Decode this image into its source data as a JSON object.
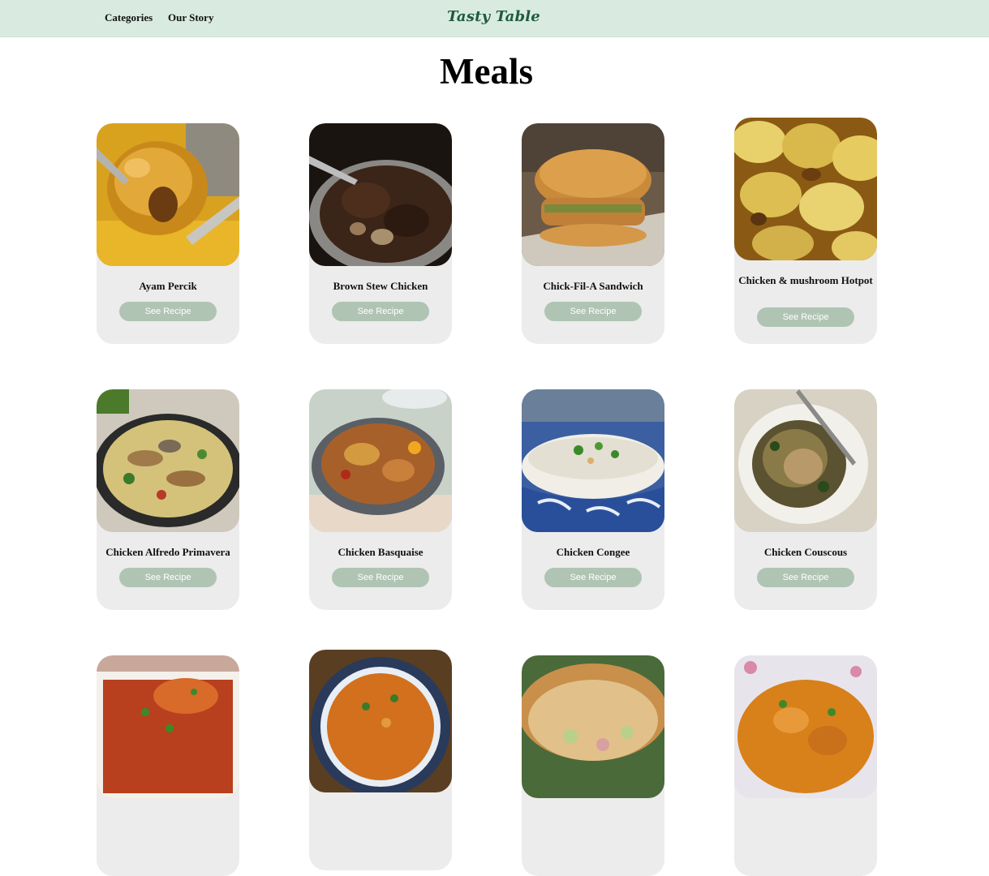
{
  "nav": {
    "categories": "Categories",
    "our_story": "Our Story",
    "brand": "Tasty Table"
  },
  "page": {
    "title": "Meals"
  },
  "meals": [
    {
      "name": "Ayam Percik",
      "button": "See Recipe"
    },
    {
      "name": "Brown Stew Chicken",
      "button": "See Recipe"
    },
    {
      "name": "Chick-Fil-A Sandwich",
      "button": "See Recipe"
    },
    {
      "name": "Chicken & mushroom Hotpot",
      "button": "See Recipe"
    },
    {
      "name": "Chicken Alfredo Primavera",
      "button": "See Recipe"
    },
    {
      "name": "Chicken Basquaise",
      "button": "See Recipe"
    },
    {
      "name": "Chicken Congee",
      "button": "See Recipe"
    },
    {
      "name": "Chicken Couscous",
      "button": "See Recipe"
    },
    {
      "name": "",
      "button": ""
    },
    {
      "name": "",
      "button": ""
    },
    {
      "name": "",
      "button": ""
    },
    {
      "name": "",
      "button": ""
    }
  ],
  "colors": {
    "header_bg": "#d9ebe0",
    "brand_text": "#1f5a3f",
    "card_bg": "#ececec",
    "button_bg": "#b0c4b4"
  }
}
